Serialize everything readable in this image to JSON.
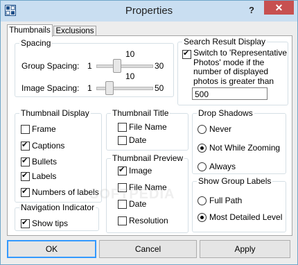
{
  "window": {
    "title": "Properties",
    "help_label": "?",
    "close_label": "✕",
    "icon": "grid-app-icon"
  },
  "tabs": [
    {
      "label": "Thumbnails",
      "active": true
    },
    {
      "label": "Exclusions",
      "active": false
    }
  ],
  "spacing": {
    "legend": "Spacing",
    "group": {
      "label": "Group Spacing:",
      "min": "1",
      "max": "30",
      "value": "10",
      "level": 0.31
    },
    "image": {
      "label": "Image Spacing:",
      "min": "1",
      "max": "50",
      "value": "10",
      "level": 0.18
    }
  },
  "search": {
    "legend": "Search Result Display",
    "checkbox_lines": [
      "Switch to 'Representative",
      "Photos' mode if the",
      "number of displayed",
      "photos is greater than"
    ],
    "checked": true,
    "value": "500"
  },
  "thumb_display": {
    "legend": "Thumbnail Display",
    "items": [
      {
        "label": "Frame",
        "checked": false
      },
      {
        "label": "Captions",
        "checked": true
      },
      {
        "label": "Bullets",
        "checked": true
      },
      {
        "label": "Labels",
        "checked": true
      },
      {
        "label": "Numbers of labels",
        "checked": true
      }
    ]
  },
  "thumb_title": {
    "legend": "Thumbnail Title",
    "items": [
      {
        "label": "File Name",
        "checked": false
      },
      {
        "label": "Date",
        "checked": false
      }
    ]
  },
  "thumb_preview": {
    "legend": "Thumbnail Preview",
    "items": [
      {
        "label": "Image",
        "checked": true
      },
      {
        "label": "File Name",
        "checked": false
      },
      {
        "label": "Date",
        "checked": false
      },
      {
        "label": "Resolution",
        "checked": false
      }
    ]
  },
  "drop_shadows": {
    "legend": "Drop Shadows",
    "options": [
      {
        "label": "Never",
        "selected": false
      },
      {
        "label": "Not While Zooming",
        "selected": true
      },
      {
        "label": "Always",
        "selected": false
      }
    ]
  },
  "group_labels": {
    "legend": "Show Group Labels",
    "options": [
      {
        "label": "Full Path",
        "selected": false
      },
      {
        "label": "Most Detailed Level",
        "selected": true
      }
    ]
  },
  "nav": {
    "legend": "Navigation Indicator",
    "items": [
      {
        "label": "Show tips",
        "checked": true
      }
    ]
  },
  "buttons": {
    "ok": "OK",
    "cancel": "Cancel",
    "apply": "Apply"
  },
  "watermark": "SOFTPEDIA"
}
